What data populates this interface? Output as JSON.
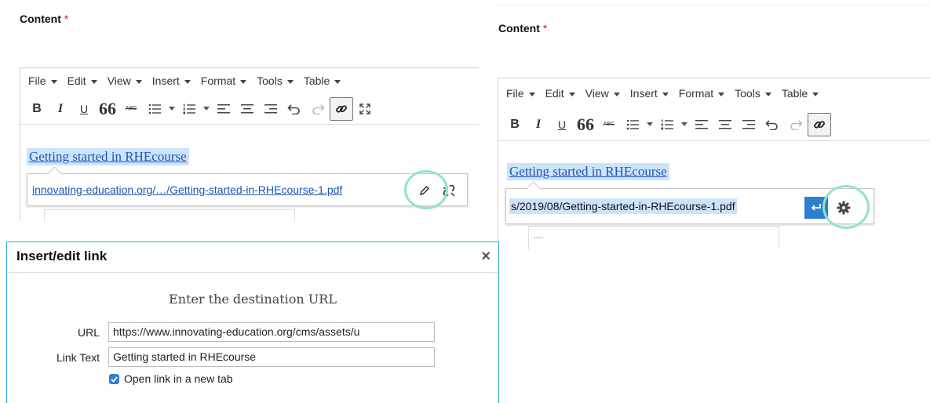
{
  "field": {
    "label": "Content",
    "required_mark": "*"
  },
  "menubar": {
    "items": [
      "File",
      "Edit",
      "View",
      "Insert",
      "Format",
      "Tools",
      "Table"
    ]
  },
  "toolbar": {
    "bold": "B",
    "italic": "I",
    "underline": "U",
    "quote": "66",
    "strike": "ABC"
  },
  "editor": {
    "link_text": "Getting started in RHEcourse"
  },
  "left_popup": {
    "url": "innovating-education.org/…/Getting-started-in-RHEcourse-1.pdf",
    "edit_icon": "pencil-icon",
    "unlink_icon": "unlink-icon"
  },
  "right_popup": {
    "url_value": "s/2019/08/Getting-started-in-RHEcourse-1.pdf",
    "apply_icon": "return-arrow-icon",
    "settings_icon": "gear-icon"
  },
  "thumb": {
    "text": "Content *"
  },
  "dialog": {
    "title": "Insert/edit link",
    "close": "×",
    "heading": "Enter the destination URL",
    "url_label": "URL",
    "url_value": "https://www.innovating-education.org/cms/assets/u",
    "link_text_label": "Link Text",
    "link_text_value": "Getting started in RHEcourse",
    "new_tab_label": "Open link in a new tab",
    "new_tab_checked": true
  },
  "colors": {
    "accent": "#2e7fd1",
    "highlight_ring": "#8fe6c1",
    "required": "#c0174c",
    "link": "#1f54b3",
    "selection": "#cde3fa"
  }
}
